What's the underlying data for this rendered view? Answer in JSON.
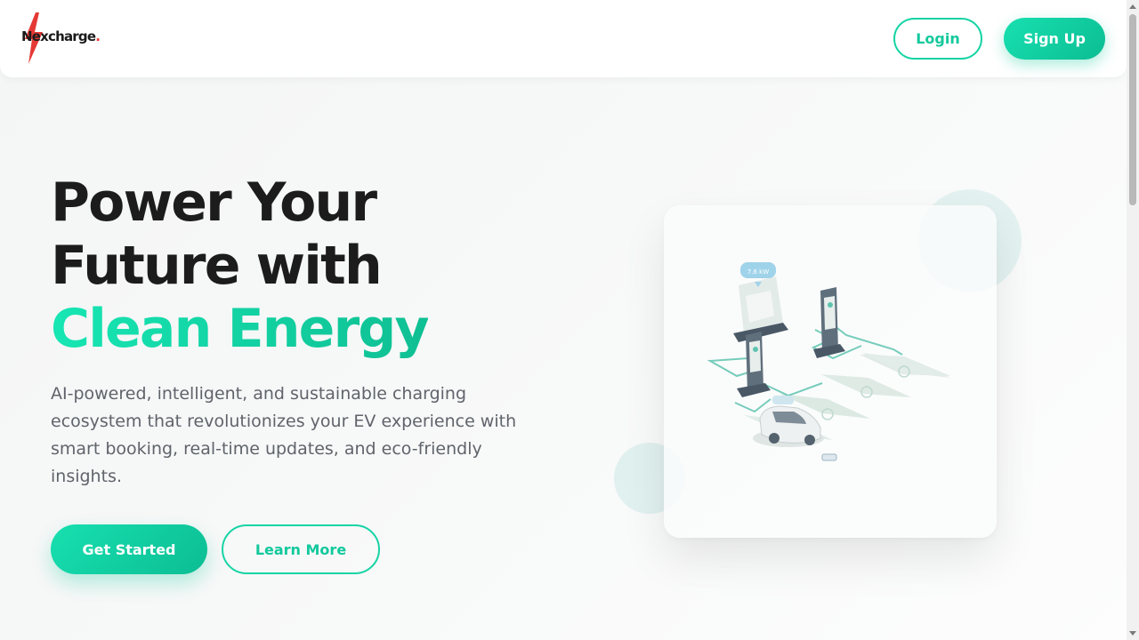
{
  "header": {
    "logo_text": "Nexcharge",
    "logo_dot": ".",
    "login_label": "Login",
    "signup_label": "Sign Up"
  },
  "hero": {
    "title_line1": "Power Your",
    "title_line2": "Future with",
    "title_accent": "Clean Energy",
    "description": "AI-powered, intelligent, and sustainable charging ecosystem that revolutionizes your EV experience with smart booking, real-time updates, and eco-friendly insights.",
    "get_started_label": "Get Started",
    "learn_more_label": "Learn More"
  },
  "illustration": {
    "icon": "ev-charging-station-illustration",
    "charger_badge": "7.6 kW"
  },
  "colors": {
    "accent": "#17d4a5",
    "accent_dark": "#0cbd93",
    "text_dark": "#1c1c1c",
    "text_muted": "#5f646b",
    "logo_bolt": "#e53935"
  }
}
